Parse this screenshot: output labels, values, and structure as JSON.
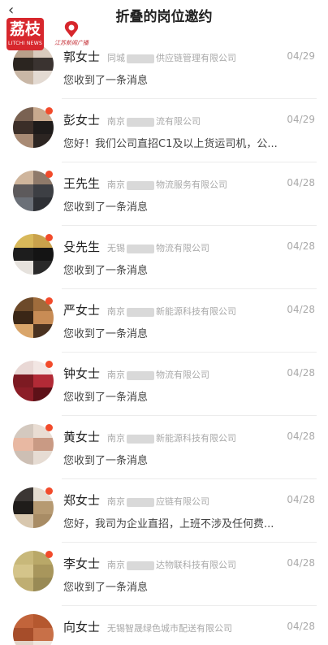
{
  "header": {
    "back_icon": "chevron-left-icon",
    "title": "折叠的岗位邀约"
  },
  "watermark": {
    "brand_text": "荔枝",
    "brand_sub": "LITCHI NEWS",
    "partner_text": "江苏新闻广播",
    "brand_color": "#d7272d"
  },
  "conversations": [
    {
      "name": "郭女士",
      "company_a": "同城",
      "company_b": "供应链管理有限公司",
      "date": "04/29",
      "message": "您收到了一条消息",
      "unread": false,
      "colors": [
        "#b8a08a",
        "#d9cbbd",
        "#2b2520",
        "#3a3330",
        "#c9b7a6",
        "#e3dad2"
      ]
    },
    {
      "name": "彭女士",
      "company_a": "南京",
      "company_b": "流有限公司",
      "date": "04/29",
      "message": "您好！我们公司直招C1及以上货运司机，公...",
      "unread": true,
      "colors": [
        "#7a6252",
        "#c8a98e",
        "#3b2e28",
        "#1e1b1a",
        "#a88a74",
        "#2c2522"
      ]
    },
    {
      "name": "王先生",
      "company_a": "南京",
      "company_b": "物流服务有限公司",
      "date": "04/28",
      "message": "您收到了一条消息",
      "unread": true,
      "colors": [
        "#cfb59c",
        "#8f7a6a",
        "#5d5a5c",
        "#3d3f44",
        "#6b7078",
        "#2e3035"
      ]
    },
    {
      "name": "殳先生",
      "company_a": "无锡",
      "company_b": "物流有限公司",
      "date": "04/28",
      "message": "您收到了一条消息",
      "unread": true,
      "colors": [
        "#d8b85a",
        "#c9a24c",
        "#1d1d1d",
        "#141414",
        "#e6e2dd",
        "#2a2a2a"
      ]
    },
    {
      "name": "严女士",
      "company_a": "南京",
      "company_b": "新能源科技有限公司",
      "date": "04/28",
      "message": "您收到了一条消息",
      "unread": true,
      "colors": [
        "#6d4a2a",
        "#a06c3c",
        "#3a2616",
        "#c88c55",
        "#d9a56a",
        "#4a3220"
      ]
    },
    {
      "name": "钟女士",
      "company_a": "南京",
      "company_b": "物流有限公司",
      "date": "04/28",
      "message": "您收到了一条消息",
      "unread": true,
      "colors": [
        "#e9d8d5",
        "#f2e6e3",
        "#7d1a22",
        "#b22a36",
        "#8c1d27",
        "#5d1118"
      ]
    },
    {
      "name": "黄女士",
      "company_a": "南京",
      "company_b": "新能源科技有限公司",
      "date": "04/28",
      "message": "您收到了一条消息",
      "unread": true,
      "colors": [
        "#d4c9bf",
        "#e9ddd3",
        "#e8b8a2",
        "#c99a84",
        "#cdbfb4",
        "#e6dcd3"
      ]
    },
    {
      "name": "郑女士",
      "company_a": "南京",
      "company_b": "应链有限公司",
      "date": "04/28",
      "message": "您好，我司为企业直招，上班不涉及任何费...",
      "unread": true,
      "colors": [
        "#3b3634",
        "#e4dbcf",
        "#1f1c1a",
        "#b69a72",
        "#d8c7ae",
        "#a88c65"
      ]
    },
    {
      "name": "李女士",
      "company_a": "南京",
      "company_b": "达物联科技有限公司",
      "date": "04/28",
      "message": "您收到了一条消息",
      "unread": true,
      "colors": [
        "#c8b87a",
        "#b9a868",
        "#d4c48a",
        "#a8965c",
        "#bfae72",
        "#998a55"
      ]
    },
    {
      "name": "向女士",
      "company_a": "无锡智晟绿色城市配送有限公司",
      "company_b": "",
      "date": "04/28",
      "message": "",
      "unread": false,
      "colors": [
        "#c2643b",
        "#b5582f",
        "#a64d2a",
        "#c87048",
        "#e2d3c8",
        "#efe6de"
      ]
    }
  ]
}
